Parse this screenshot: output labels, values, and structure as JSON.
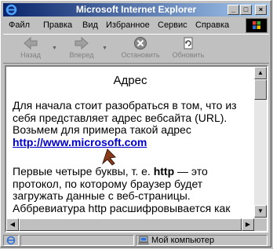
{
  "window": {
    "title": "Microsoft Internet Explorer"
  },
  "controls": {
    "minimize": "_",
    "maximize": "□",
    "close": "×"
  },
  "menu": [
    {
      "label": "Файл"
    },
    {
      "label": "Правка"
    },
    {
      "label": "Вид"
    },
    {
      "label": "Избранное"
    },
    {
      "label": "Сервис"
    },
    {
      "label": "Справка"
    }
  ],
  "toolbar": {
    "back_label": "Назад",
    "forward_label": "Вперед",
    "stop_label": "Остановить",
    "refresh_label": "Обновить"
  },
  "page": {
    "title": "Адрес",
    "para1": "Для начала стоит разобраться в том, что из себя представляет адрес вебсайта (URL). Возьмем для примера такой адрес",
    "link": "http://www.microsoft.com",
    "para2_start": "Первые четыре буквы, т. е. ",
    "para2_http": "http",
    "para2_rest": " — это протокол, по которому браузер будет загружать данные с веб-страницы. Аббревиатура http расшифровывается как"
  },
  "status": {
    "zone": "Мой компьютер"
  },
  "colors": {
    "title_start": "#0a246a",
    "title_end": "#a6caf0",
    "link": "#0000cc"
  }
}
